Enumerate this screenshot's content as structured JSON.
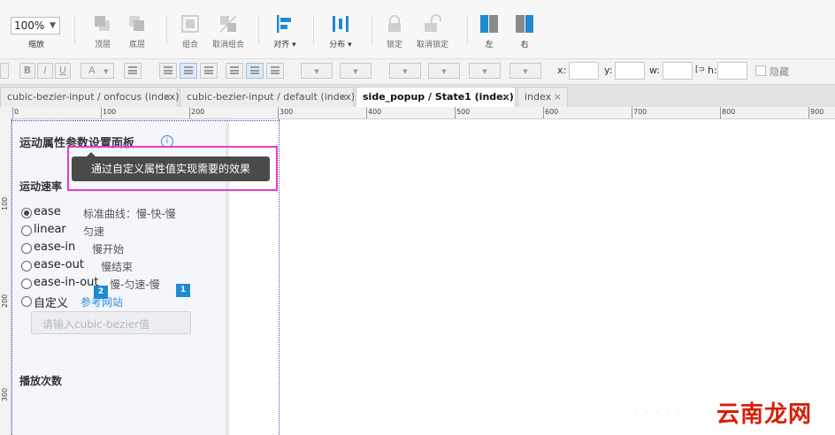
{
  "toolbar": {
    "zoom_value": "100%",
    "zoom_label": "缩放",
    "tools": [
      {
        "label": "顶层"
      },
      {
        "label": "底层"
      },
      {
        "label": "组合"
      },
      {
        "label": "取消组合"
      },
      {
        "label": "对齐 ▾"
      },
      {
        "label": "分布 ▾"
      },
      {
        "label": "锁定"
      },
      {
        "label": "取消锁定"
      },
      {
        "label": "左"
      },
      {
        "label": "右"
      }
    ]
  },
  "format_bar": {
    "bold": "B",
    "italic": "I",
    "underline": "U",
    "font_color": "A",
    "x_label": "x:",
    "y_label": "y:",
    "w_label": "w:",
    "h_label": "h:",
    "hidden_label": "隐藏"
  },
  "tabs": [
    {
      "label": "cubic-bezier-input / onfocus (index)",
      "close": "×",
      "active": false
    },
    {
      "label": "cubic-bezier-input / default (index)",
      "close": "×",
      "active": false
    },
    {
      "label": "side_popup / State1 (index)",
      "close": "×",
      "active": true
    },
    {
      "label": "index",
      "close": "×",
      "active": false
    }
  ],
  "ruler": {
    "top": [
      "0",
      "100",
      "200",
      "300",
      "400",
      "500",
      "600",
      "700",
      "800",
      "900"
    ],
    "left": [
      "100",
      "200",
      "300"
    ]
  },
  "panel": {
    "title": "运动属性参数设置面板",
    "info_icon": "i",
    "speed_title": "运动速率",
    "options": [
      {
        "name": "ease",
        "desc": "标准曲线：慢-快-慢",
        "selected": true
      },
      {
        "name": "linear",
        "desc": "匀速",
        "selected": false
      },
      {
        "name": "ease-in",
        "desc": "慢开始",
        "selected": false
      },
      {
        "name": "ease-out",
        "desc": "慢结束",
        "selected": false
      },
      {
        "name": "ease-in-out",
        "desc": "慢-匀速-慢",
        "selected": false
      },
      {
        "name": "自定义",
        "desc": "参考网站",
        "selected": false
      }
    ],
    "input_placeholder": "请输入cubic-bezier值",
    "play_title": "播放次数",
    "badges": [
      "2",
      "1"
    ]
  },
  "tooltip": {
    "text": "通过自定义属性值实现需要的效果"
  },
  "watermark": {
    "text": "云南龙网"
  },
  "colors": {
    "accent_blue": "#1f8ad1",
    "highlight_magenta": "#e33bd0",
    "watermark_red": "#d81e06",
    "tooltip_bg": "#4a4a4a"
  }
}
